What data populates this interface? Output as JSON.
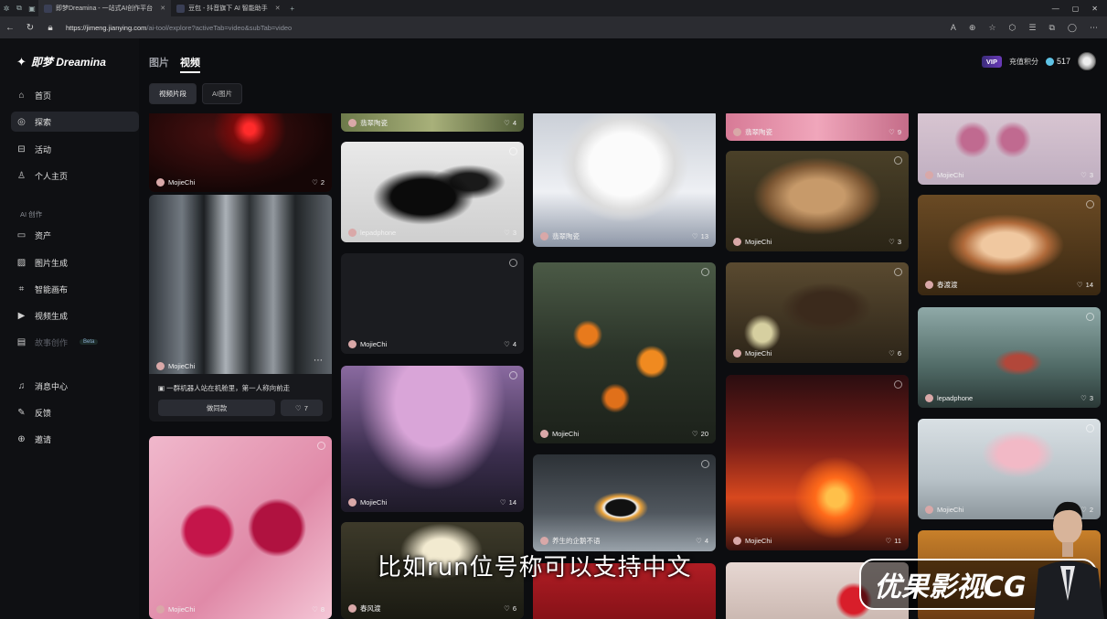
{
  "browser": {
    "tabs": [
      {
        "label": "即梦Dreamina - 一站式AI创作平台"
      },
      {
        "label": "豆包 - 抖音旗下 AI 智能助手"
      }
    ],
    "url_host": "https://jimeng.jianying.com",
    "url_path": "/ai-tool/explore?activeTab=video&subTab=video"
  },
  "sidebar": {
    "logo": "即梦 Dreamina",
    "items_top": [
      {
        "label": "首页",
        "icon": "home-icon"
      },
      {
        "label": "探索",
        "icon": "compass-icon"
      },
      {
        "label": "活动",
        "icon": "gift-icon"
      },
      {
        "label": "个人主页",
        "icon": "user-icon"
      }
    ],
    "section_label": "AI 创作",
    "items_ai": [
      {
        "label": "资产",
        "icon": "folder-icon"
      },
      {
        "label": "图片生成",
        "icon": "image-icon"
      },
      {
        "label": "智能画布",
        "icon": "canvas-icon"
      },
      {
        "label": "视频生成",
        "icon": "video-icon"
      },
      {
        "label": "故事创作",
        "icon": "story-icon",
        "badge": "Beta"
      }
    ],
    "items_bottom": [
      {
        "label": "消息中心",
        "icon": "bell-icon"
      },
      {
        "label": "反馈",
        "icon": "feedback-icon"
      },
      {
        "label": "邀请",
        "icon": "invite-icon"
      }
    ]
  },
  "header": {
    "tabs": [
      "图片",
      "视频"
    ],
    "active_tab": "视频",
    "sub_tabs": [
      "视频片段",
      "AI图片"
    ],
    "vip": "VIP",
    "credits_label": "充值积分",
    "credits": "517"
  },
  "cards": {
    "c1": {
      "author": "MojieChi",
      "likes": "2"
    },
    "c2": {
      "author": "MojieChi",
      "prompt": "一群机器人站在机舱里，第一人称向前走",
      "similar": "做同款",
      "likes": "7"
    },
    "c3": {
      "author": "MojieChi",
      "likes": "8"
    },
    "d1": {
      "author": "翡翠陶瓷",
      "likes": "4"
    },
    "d2": {
      "author": "lepadphone",
      "likes": "3"
    },
    "d3": {
      "author": "MojieChi",
      "likes": "4"
    },
    "d4": {
      "author": "MojieChi",
      "likes": "14"
    },
    "d5": {
      "author": "春风渡",
      "likes": "6"
    },
    "e1": {
      "author": "翡翠陶瓷",
      "likes": "13"
    },
    "e2": {
      "author": "MojieChi",
      "likes": "20"
    },
    "e3": {
      "author": "养生的企鹅不语",
      "likes": "4"
    },
    "f1": {
      "author": "翡翠陶瓷",
      "likes": "9"
    },
    "f2": {
      "author": "MojieChi",
      "likes": "3"
    },
    "f3": {
      "author": "MojieChi",
      "likes": "6"
    },
    "f4": {
      "author": "MojieChi",
      "likes": "11"
    },
    "g1": {
      "author": "MojieChi",
      "likes": "3"
    },
    "g2": {
      "author": "春渡渡",
      "likes": "14"
    },
    "g3": {
      "author": "lepadphone",
      "likes": "3"
    },
    "g4": {
      "author": "MojieChi",
      "likes": "2"
    }
  },
  "overlay": {
    "subtitle": "比如run位号称可以支持中文",
    "watermark": "优果影视CG"
  }
}
